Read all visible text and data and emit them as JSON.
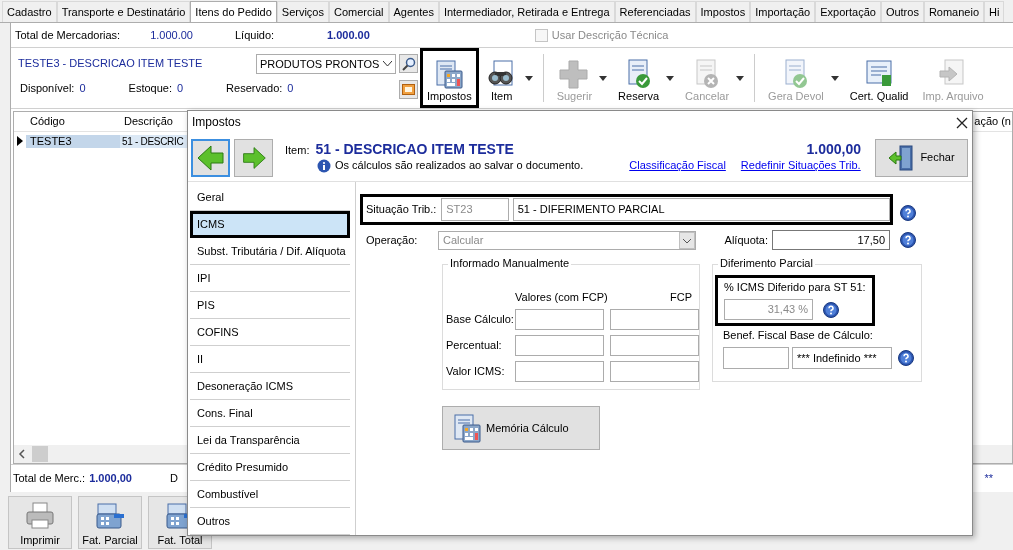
{
  "main_tabs": [
    {
      "label": "Cadastro",
      "selected": false
    },
    {
      "label": "Transporte e Destinatário",
      "selected": false
    },
    {
      "label": "Itens do Pedido",
      "selected": true
    },
    {
      "label": "Serviços",
      "selected": false
    },
    {
      "label": "Comercial",
      "selected": false
    },
    {
      "label": "Agentes",
      "selected": false
    },
    {
      "label": "Intermediador, Retirada e Entrega",
      "selected": false
    },
    {
      "label": "Referenciadas",
      "selected": false
    },
    {
      "label": "Impostos",
      "selected": false
    },
    {
      "label": "Importação",
      "selected": false
    },
    {
      "label": "Exportação",
      "selected": false
    },
    {
      "label": "Outros",
      "selected": false
    },
    {
      "label": "Romaneio",
      "selected": false
    },
    {
      "label": "Hi",
      "selected": false
    }
  ],
  "totals": {
    "mercadorias_label": "Total de Mercadorias:",
    "mercadorias_value": "1.000.00",
    "liquido_label": "Líquido:",
    "liquido_value": "1.000.00",
    "tech_desc": {
      "label": "Usar Descrição Técnica",
      "checked": false,
      "disabled": true
    }
  },
  "item": {
    "title": "TESTE3 - DESCRICAO ITEM TESTE",
    "category": "PRODUTOS PRONTOS",
    "stock": [
      {
        "label": "Disponível:",
        "value": "0"
      },
      {
        "label": "Estoque:",
        "value": "0"
      },
      {
        "label": "Reservado:",
        "value": "0"
      }
    ]
  },
  "toolbar": [
    {
      "label": "Impostos",
      "disabled": false,
      "dropdown": false,
      "highlighted": true
    },
    {
      "label": "Item",
      "disabled": false,
      "dropdown": true,
      "highlighted": false
    },
    {
      "label": "Sugerir",
      "disabled": true,
      "dropdown": true,
      "highlighted": false
    },
    {
      "label": "Reserva",
      "disabled": false,
      "dropdown": true,
      "highlighted": false
    },
    {
      "label": "Cancelar",
      "disabled": true,
      "dropdown": true,
      "highlighted": false
    },
    {
      "label": "Gera Devol",
      "disabled": true,
      "dropdown": true,
      "highlighted": false
    },
    {
      "label": "Cert. Qualid",
      "disabled": false,
      "dropdown": false,
      "highlighted": false
    },
    {
      "label": "Imp. Arquivo",
      "disabled": true,
      "dropdown": false,
      "highlighted": false
    }
  ],
  "grid": {
    "columns": [
      "Código",
      "Descrição"
    ],
    "right_fragment": "ação (n",
    "rows": [
      {
        "cells": [
          "TESTE3",
          "51 - DESCRIC"
        ],
        "selected": true
      }
    ]
  },
  "summary": {
    "label": "Total de Merc.:",
    "value": "1.000,00",
    "fragment": "D",
    "right_fragment": "**"
  },
  "bottom_buttons": [
    "Imprimir",
    "Fat. Parcial",
    "Fat. Total"
  ],
  "dialog": {
    "title": "Impostos",
    "item_label": "Item:",
    "item_name": "51 - DESCRICAO ITEM TESTE",
    "amount": "1.000,00",
    "note": "Os cálculos são realizados ao salvar o documento.",
    "links": [
      "Classificação Fiscal",
      "Redefinir Situações Trib."
    ],
    "close_button": "Fechar",
    "nav": [
      {
        "label": "Geral",
        "selected": false,
        "highlighted": false
      },
      {
        "label": "ICMS",
        "selected": true,
        "highlighted": true
      },
      {
        "label": "Subst. Tributária / Dif. Alíquota",
        "selected": false,
        "highlighted": false
      },
      {
        "label": "IPI",
        "selected": false,
        "highlighted": false
      },
      {
        "label": "PIS",
        "selected": false,
        "highlighted": false
      },
      {
        "label": "COFINS",
        "selected": false,
        "highlighted": false
      },
      {
        "label": "II",
        "selected": false,
        "highlighted": false
      },
      {
        "label": "Desoneração ICMS",
        "selected": false,
        "highlighted": false
      },
      {
        "label": "Cons. Final",
        "selected": false,
        "highlighted": false
      },
      {
        "label": "Lei da Transparência",
        "selected": false,
        "highlighted": false
      },
      {
        "label": "Crédito Presumido",
        "selected": false,
        "highlighted": false
      },
      {
        "label": "Combustível",
        "selected": false,
        "highlighted": false
      },
      {
        "label": "Outros",
        "selected": false,
        "highlighted": false
      }
    ],
    "icms": {
      "situacao": {
        "label": "Situação Trib.:",
        "code": "ST23",
        "description": "51 - DIFERIMENTO PARCIAL",
        "highlighted": true
      },
      "operacao": {
        "label": "Operação:",
        "value": "Calcular",
        "disabled": true
      },
      "aliquota": {
        "label": "Alíquota:",
        "value": "17,50"
      },
      "manual": {
        "title": "Informado Manualmente",
        "columns": [
          "Valores (com FCP)",
          "FCP"
        ],
        "rows": [
          "Base Cálculo:",
          "Percentual:",
          "Valor ICMS:"
        ]
      },
      "diferimento": {
        "title": "Diferimento Parcial",
        "percent_label": "% ICMS Diferido para ST 51:",
        "percent_value": "31,43 %",
        "highlighted": true,
        "benef_label": "Benef. Fiscal Base de Cálculo:",
        "benef_value": "*** Indefinido ***"
      },
      "memoria_button": "Memória Cálculo"
    }
  }
}
